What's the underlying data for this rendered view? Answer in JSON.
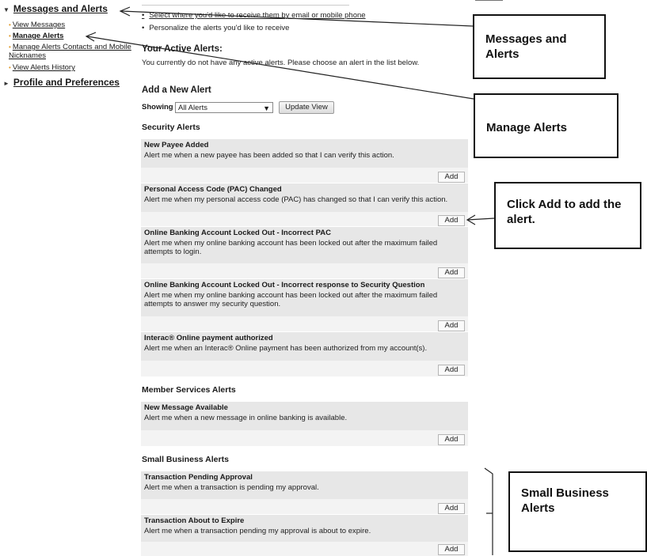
{
  "nav": {
    "messages_alerts": "Messages and Alerts",
    "view_messages": "View Messages",
    "manage_alerts": "Manage Alerts",
    "manage_contacts": "Manage Alerts Contacts and Mobile Nicknames",
    "view_history": "View Alerts History",
    "profile": "Profile and Preferences"
  },
  "intro": {
    "select_line": "Select where you'd like to receive them by email or mobile phone",
    "personalize_line": "Personalize the alerts you'd like to receive"
  },
  "active": {
    "header": "Your Active Alerts:",
    "empty_text": "You currently do not have any active alerts. Please choose an alert in the list below."
  },
  "add_new": {
    "header": "Add a New Alert",
    "showing_label": "Showing",
    "filter_value": "All Alerts",
    "update_button": "Update View"
  },
  "add_label": "Add",
  "sections": [
    {
      "title": "Security Alerts",
      "alerts": [
        {
          "title": "New Payee Added",
          "desc": "Alert me when a new payee has been added so that I can verify this action."
        },
        {
          "title": "Personal Access Code (PAC) Changed",
          "desc": "Alert me when my personal access code (PAC) has changed so that I can verify this action."
        },
        {
          "title": "Online Banking Account Locked Out - Incorrect PAC",
          "desc": "Alert me when my online banking account has been locked out after the maximum failed attempts to login."
        },
        {
          "title": "Online Banking Account Locked Out - Incorrect response to Security Question",
          "desc": "Alert me when my online banking account has been locked out after the maximum failed attempts to answer my security question."
        },
        {
          "title": "Interac® Online payment authorized",
          "desc": "Alert me when an Interac® Online payment has been authorized from my account(s)."
        }
      ]
    },
    {
      "title": "Member Services Alerts",
      "alerts": [
        {
          "title": "New Message Available",
          "desc": "Alert me when a new message in online banking is available."
        }
      ]
    },
    {
      "title": "Small Business Alerts",
      "alerts": [
        {
          "title": "Transaction Pending Approval",
          "desc": "Alert me when a transaction is pending my approval."
        },
        {
          "title": "Transaction About to Expire",
          "desc": "Alert me when a transaction pending my approval is about to expire."
        }
      ]
    }
  ],
  "callouts": {
    "messages_alerts": "Messages and Alerts",
    "manage_alerts": "Manage Alerts",
    "click_add": "Click Add to add the alert.",
    "small_business": "Small Business Alerts"
  }
}
